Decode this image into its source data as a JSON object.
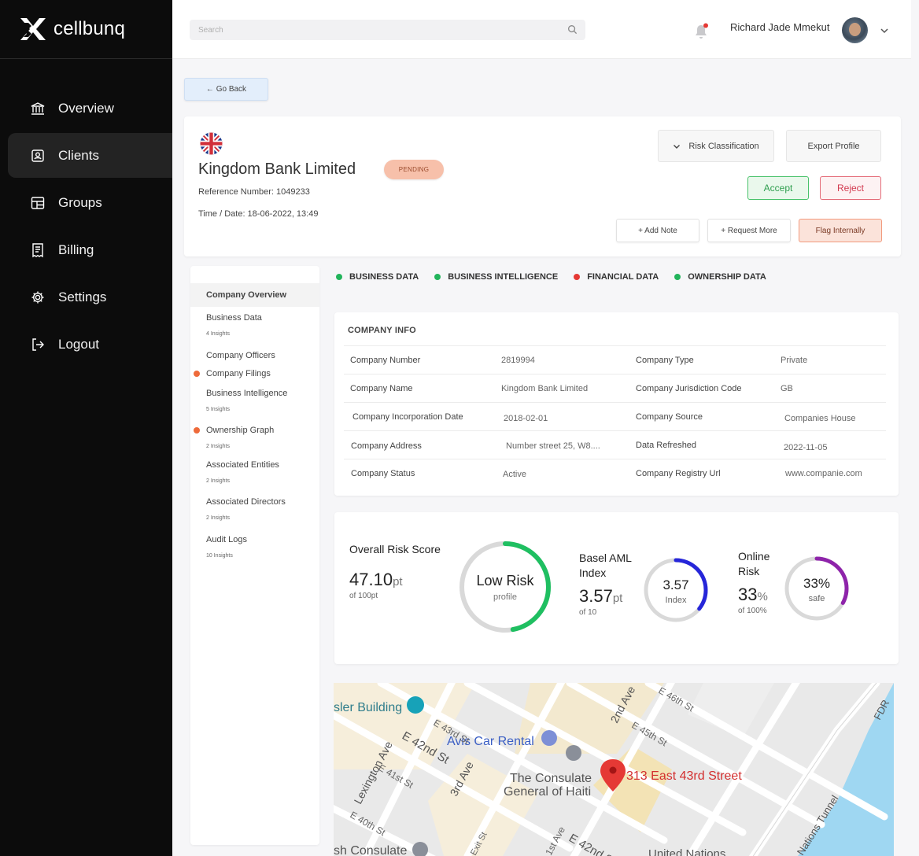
{
  "brand": {
    "name": "cellbunq"
  },
  "nav": [
    {
      "label": "Overview",
      "icon": "bank-icon",
      "active": false
    },
    {
      "label": "Clients",
      "icon": "client-icon",
      "active": true
    },
    {
      "label": "Groups",
      "icon": "groups-icon",
      "active": false
    },
    {
      "label": "Billing",
      "icon": "receipt-icon",
      "active": false
    },
    {
      "label": "Settings",
      "icon": "gear-icon",
      "active": false
    },
    {
      "label": "Logout",
      "icon": "logout-icon",
      "active": false
    }
  ],
  "header": {
    "search_placeholder": "Search",
    "user_name": "Richard Jade Mmekut",
    "notification_color": "#e53935"
  },
  "go_back": "← Go Back",
  "company": {
    "name": "Kingdom Bank Limited",
    "status": "PENDING",
    "reference": "Reference Number: 1049233",
    "datetime": "Time / Date: 18-06-2022, 13:49"
  },
  "actions": {
    "risk_classification": "Risk Classification",
    "export_profile": "Export Profile",
    "accept": "Accept",
    "reject": "Reject",
    "add_note": "+ Add Note",
    "request_more": "+ Request More",
    "flag_internally": "Flag Internally"
  },
  "left_menu": {
    "title": "Company Overview",
    "items": [
      {
        "label": "Business Data",
        "sub": "4 Insights",
        "dot": ""
      },
      {
        "label": "Company Officers",
        "sub": "",
        "dot": ""
      },
      {
        "label": "Company Filings",
        "sub": "",
        "dot": "#ee6a3a"
      },
      {
        "label": "Business Intelligence",
        "sub": "5 Insights",
        "dot": ""
      },
      {
        "label": "Ownership Graph",
        "sub": "2 Insights",
        "dot": "#ee6a3a"
      },
      {
        "label": "Associated Entities",
        "sub": "2 Insights",
        "dot": ""
      },
      {
        "label": "Associated Directors",
        "sub": "2 Insights",
        "dot": ""
      },
      {
        "label": "Audit Logs",
        "sub": "10 Insights",
        "dot": ""
      }
    ]
  },
  "categories": [
    {
      "label": "BUSINESS DATA",
      "color": "#22b45b"
    },
    {
      "label": "BUSINESS INTELLIGENCE",
      "color": "#22b45b"
    },
    {
      "label": "FINANCIAL DATA",
      "color": "#e53935"
    },
    {
      "label": "OWNERSHIP DATA",
      "color": "#22b45b"
    }
  ],
  "company_info": {
    "title": "COMPANY INFO",
    "rows": [
      {
        "l1": "Company Number",
        "v1": "2819994",
        "l2": "Company Type",
        "v2": "Private"
      },
      {
        "l1": "Company Name",
        "v1": "Kingdom Bank Limited",
        "l2": "Company Jurisdiction Code",
        "v2": "GB"
      },
      {
        "l1": "Company Incorporation Date",
        "v1": "2018-02-01",
        "l2": "Company Source",
        "v2": "Companies House"
      },
      {
        "l1": "Company Address",
        "v1": "Number street 25, W8....",
        "l2": "Data Refreshed",
        "v2": "2022-11-05"
      },
      {
        "l1": "Company Status",
        "v1": "Active",
        "l2": "Company Registry Url",
        "v2": "www.companie.com"
      }
    ]
  },
  "risk": {
    "overall": {
      "label": "Overall Risk Score",
      "value": "47.10",
      "unit": "pt",
      "of": "of 100pt",
      "ring_title": "Low Risk",
      "ring_sub": "profile",
      "fraction": 0.471,
      "color": "#1fbf61"
    },
    "basel": {
      "label1": "Basel AML",
      "label2": "Index",
      "value": "3.57",
      "unit": "pt",
      "of": "of 10",
      "ring_title": "3.57",
      "ring_sub": "Index",
      "fraction": 0.357,
      "color": "#2626d9"
    },
    "online": {
      "label1": "Online",
      "label2": "Risk",
      "value": "33",
      "unit": "%",
      "of": "of 100%",
      "ring_title": "33%",
      "ring_sub": "safe",
      "fraction": 0.33,
      "color": "#8e24aa"
    }
  },
  "map": {
    "pin_label": "313 East 43rd Street",
    "streets": [
      "E 43rd St",
      "E 42nd St",
      "E 41st St",
      "E 40th St",
      "E 45th St",
      "E 46th St",
      "2nd Ave",
      "3rd Ave",
      "Lexington Ave",
      "E 42nd St",
      "1st Ave",
      "Exit St",
      "Nations Tunnel",
      "FDR"
    ],
    "places": [
      "sler Building",
      "Avis Car Rental",
      "The Consulate",
      "General of Haiti",
      "sh Consulate",
      "United Nations"
    ]
  }
}
